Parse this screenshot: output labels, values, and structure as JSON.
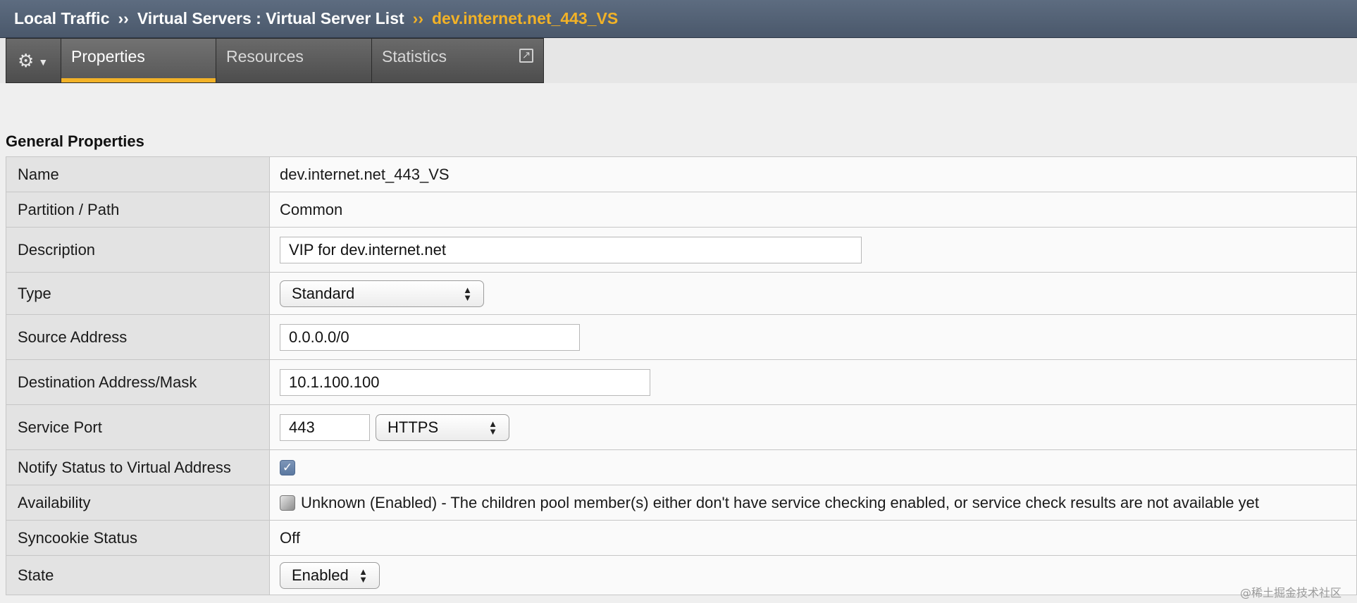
{
  "breadcrumb": {
    "items": [
      "Local Traffic",
      "Virtual Servers : Virtual Server List"
    ],
    "separator": "››",
    "current": "dev.internet.net_443_VS"
  },
  "tabs": {
    "gear_icon": "gear-icon",
    "items": [
      {
        "label": "Properties",
        "active": true
      },
      {
        "label": "Resources",
        "active": false
      },
      {
        "label": "Statistics",
        "active": false,
        "icon": "popout-icon"
      }
    ]
  },
  "general_properties": {
    "title": "General Properties",
    "rows": {
      "name": {
        "label": "Name",
        "value": "dev.internet.net_443_VS"
      },
      "partition": {
        "label": "Partition / Path",
        "value": "Common"
      },
      "description": {
        "label": "Description",
        "value": "VIP for dev.internet.net"
      },
      "type": {
        "label": "Type",
        "value": "Standard"
      },
      "source": {
        "label": "Source Address",
        "value": "0.0.0.0/0"
      },
      "destination": {
        "label": "Destination Address/Mask",
        "value": "10.1.100.100"
      },
      "service_port": {
        "label": "Service Port",
        "port": "443",
        "protocol": "HTTPS"
      },
      "notify": {
        "label": "Notify Status to Virtual Address",
        "checked": true
      },
      "availability": {
        "label": "Availability",
        "value": "Unknown (Enabled) - The children pool member(s) either don't have service checking enabled, or service check results are not available yet"
      },
      "syncookie": {
        "label": "Syncookie Status",
        "value": "Off"
      },
      "state": {
        "label": "State",
        "value": "Enabled"
      }
    }
  },
  "watermark": "@稀土掘金技术社区",
  "colors": {
    "accent": "#f2b227",
    "header_bg": "#4f5d70",
    "tab_bg": "#5a5a5a",
    "label_bg": "#e3e3e3"
  }
}
